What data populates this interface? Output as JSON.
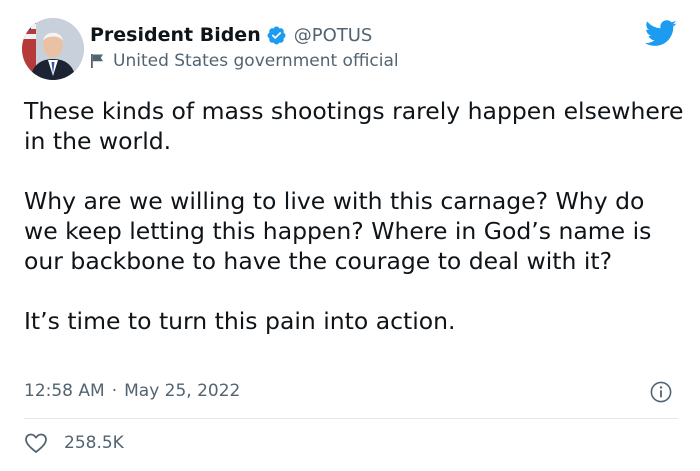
{
  "account": {
    "display_name": "President Biden",
    "handle": "@POTUS",
    "label": "United States government official"
  },
  "tweet": {
    "paragraphs": [
      "These kinds of mass shootings rarely happen elsewhere in the world.",
      "Why are we willing to live with this carnage? Why do we keep letting this happen? Where in God’s name is our backbone to have the courage to deal with it?",
      "It’s time to turn this pain into action."
    ],
    "time": "12:58 AM",
    "separator": "·",
    "date": "May 25, 2022"
  },
  "engagement": {
    "likes": "258.5K"
  },
  "icons": {
    "verified": "verified-badge-icon",
    "flag": "government-flag-icon",
    "brand": "twitter-bird-icon",
    "info": "info-icon",
    "like": "heart-icon"
  },
  "colors": {
    "twitter_blue": "#1d9bf0",
    "text_primary": "#0f1419",
    "text_secondary": "#536471",
    "divider": "#e3e8ec"
  }
}
